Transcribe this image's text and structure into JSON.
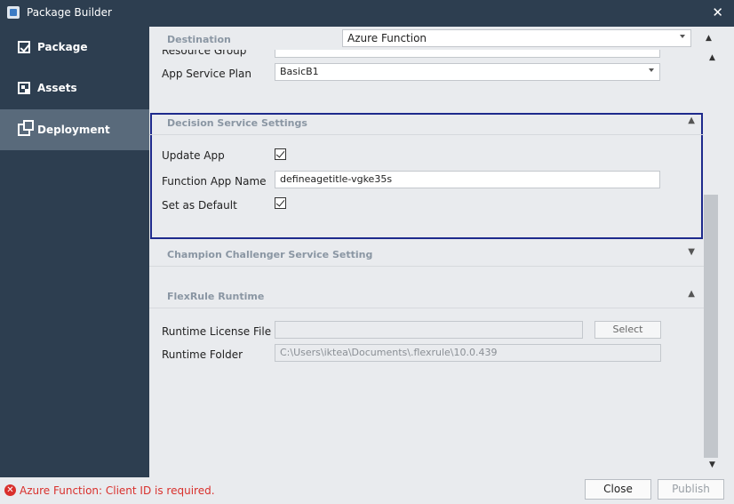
{
  "window": {
    "title": "Package Builder"
  },
  "sidebar": {
    "items": [
      {
        "label": "Package",
        "icon": "check-icon"
      },
      {
        "label": "Assets",
        "icon": "assets-icon"
      },
      {
        "label": "Deployment",
        "icon": "deploy-icon",
        "active": true
      }
    ]
  },
  "destination": {
    "label": "Destination",
    "value": "Azure Function"
  },
  "resource_group": {
    "label": "Resource Group"
  },
  "app_service_plan": {
    "label": "App Service Plan",
    "value": "BasicB1"
  },
  "decision_service": {
    "title": "Decision Service Settings",
    "update_app": {
      "label": "Update App",
      "checked": true
    },
    "function_app_name": {
      "label": "Function App Name",
      "value": "defineagetitle-vgke35s"
    },
    "set_as_default": {
      "label": "Set as Default",
      "checked": true
    }
  },
  "champion_challenger": {
    "title": "Champion Challenger Service Setting"
  },
  "flexrule_runtime": {
    "title": "FlexRule Runtime",
    "license_file": {
      "label": "Runtime License File",
      "value": ""
    },
    "select_button": "Select",
    "runtime_folder": {
      "label": "Runtime Folder",
      "value": "C:\\Users\\iktea\\Documents\\.flexrule\\10.0.439"
    }
  },
  "status": {
    "error": "Azure Function: Client ID is required."
  },
  "footer": {
    "close": "Close",
    "publish": "Publish"
  },
  "colors": {
    "sidebar": "#2d3e50",
    "active": "#596a7b",
    "highlight": "#1e2a8c",
    "error": "#d9302c"
  }
}
